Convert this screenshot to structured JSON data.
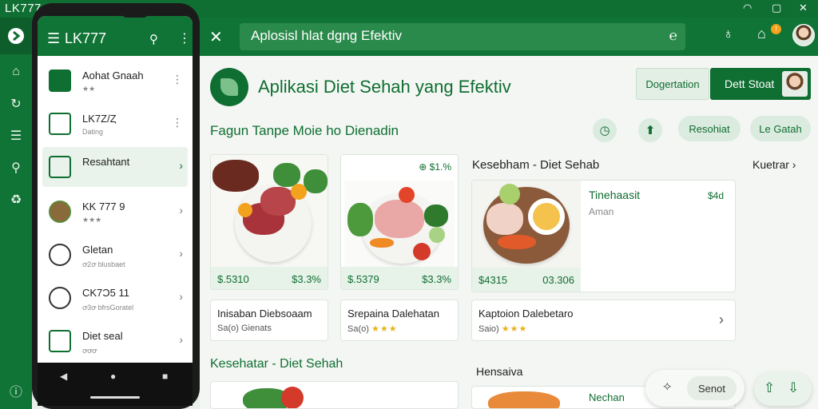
{
  "window": {
    "app_title": "LK777",
    "icons": [
      "wifi-icon",
      "maximize-icon",
      "close-icon"
    ]
  },
  "left_rail": {
    "icons": [
      "app-logo-icon",
      "home-icon",
      "refresh-icon",
      "list-icon",
      "link-icon",
      "recycle-icon",
      "info-icon"
    ]
  },
  "topbar": {
    "search_value": "Aplosisl hlat dgng Efektiv",
    "icons": [
      "close-icon",
      "clear-search-icon",
      "location-icon",
      "notification-icon",
      "user-avatar"
    ],
    "notification_count": "!"
  },
  "phone": {
    "title": "LK777",
    "items": [
      {
        "title": "Aohat Gnaah",
        "sub": "★★",
        "trail": "⋮"
      },
      {
        "title": "LK7Z/Ȥ",
        "sub": "Dating",
        "trail": "⋮"
      },
      {
        "title": "Resahtant",
        "sub": "",
        "trail": "›"
      },
      {
        "title": "KK 777 9",
        "sub": "★★★",
        "trail": "›"
      },
      {
        "title": "Gletan",
        "sub": "ꝍ2ꝍ blusbaet",
        "trail": "›"
      },
      {
        "title": "CK7Ɔ5 11",
        "sub": "ꝍ3ꝍ bfrsGoratel",
        "trail": "›"
      },
      {
        "title": "Diet seal",
        "sub": "ꝍꝍꝍ",
        "trail": "›"
      }
    ]
  },
  "main": {
    "title": "Aplikasi Diet Sehah yang Efektiv",
    "buttons": {
      "outline": "Dogertation",
      "primary": "Dett Stoat"
    },
    "subtitle": "Fagun Tanpe Moie ho Dienadin",
    "pills": [
      "Resohiat",
      "Le Gatah"
    ],
    "section1": "Kesebham - Diet Sehab",
    "section1_link": "Kuetrar ›",
    "section2": "Kesehatar - Diet Sehah",
    "section3": "Hensaiva",
    "cards": [
      {
        "price_left": "$.5310",
        "price_right": "$3.3%"
      },
      {
        "top_tag": "⊕ $1.%",
        "price_left": "$.5379",
        "price_right": "$3.3%"
      },
      {
        "title": "Tinehaasit",
        "right": "$4d",
        "sub": "Aman",
        "price_left": "$4315",
        "price_right": "03.306"
      }
    ],
    "list_cards": [
      {
        "title": "Inisaban Diebsoaam",
        "sub": "Sa(o) Gienats",
        "stars": ""
      },
      {
        "title": "Srepaina Dalehatan",
        "sub": "Sa(o)",
        "stars": "★★★"
      },
      {
        "title": "Kaptoion Dalebetaro",
        "sub": "Saio)",
        "stars": "★★★",
        "trail": "›"
      }
    ],
    "bottom_card_label": "Nechan"
  },
  "floating": {
    "pill_label": "Senot"
  }
}
